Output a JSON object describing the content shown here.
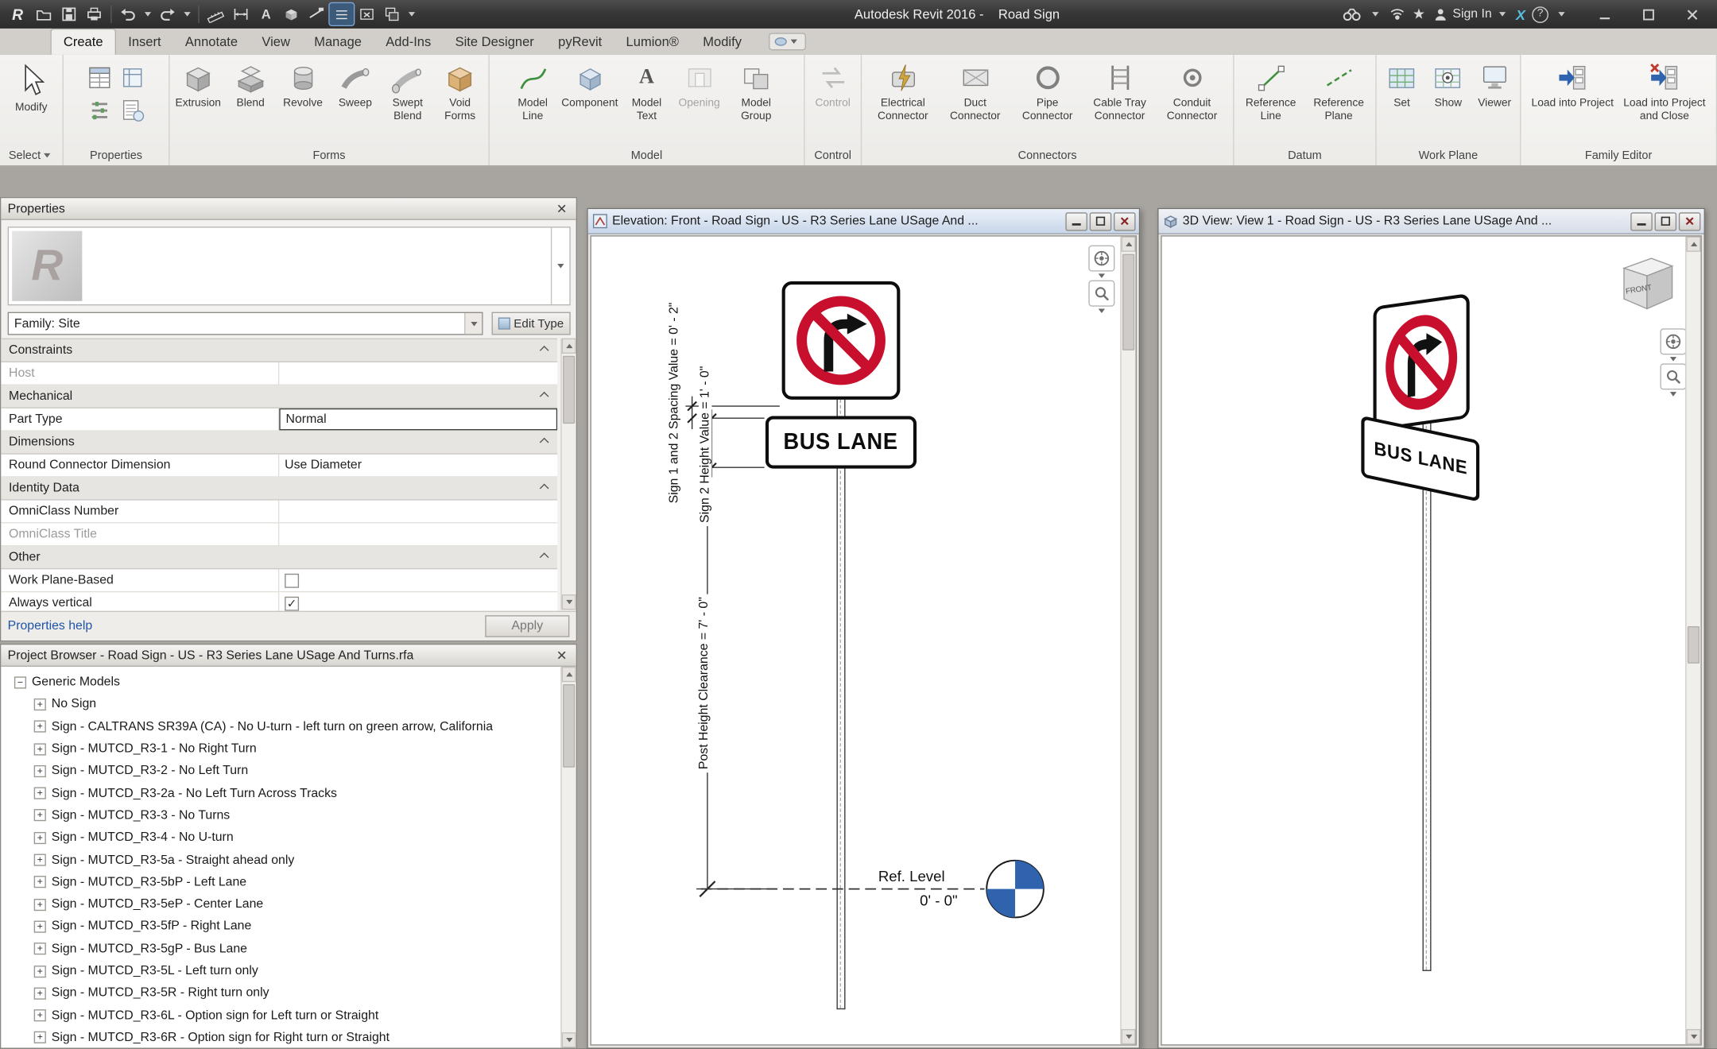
{
  "colors": {
    "sign_red": "#c8102e",
    "level_blue": "#2f63ad"
  },
  "titlebar": {
    "title": "Autodesk Revit 2016 -    Road Sign",
    "sign_in": "Sign In"
  },
  "tabs": [
    "Create",
    "Insert",
    "Annotate",
    "View",
    "Manage",
    "Add-Ins",
    "Site Designer",
    "pyRevit",
    "Lumion®",
    "Modify"
  ],
  "ribbon": {
    "select": {
      "modify": "Modify",
      "label": "Select"
    },
    "properties": {
      "label": "Properties"
    },
    "forms": {
      "label": "Forms",
      "buttons": [
        "Extrusion",
        "Blend",
        "Revolve",
        "Sweep",
        "Swept Blend",
        "Void Forms"
      ]
    },
    "model": {
      "label": "Model",
      "buttons": [
        "Model Line",
        "Component",
        "Model Text",
        "Opening",
        "Model Group"
      ]
    },
    "control": {
      "label": "Control",
      "buttons": [
        "Control"
      ]
    },
    "connectors": {
      "label": "Connectors",
      "buttons": [
        "Electrical Connector",
        "Duct Connector",
        "Pipe Connector",
        "Cable Tray Connector",
        "Conduit Connector"
      ]
    },
    "datum": {
      "label": "Datum",
      "buttons": [
        "Reference Line",
        "Reference Plane"
      ]
    },
    "workplane": {
      "label": "Work Plane",
      "buttons": [
        "Set",
        "Show",
        "Viewer"
      ]
    },
    "family_editor": {
      "label": "Family Editor",
      "buttons": [
        "Load into Project",
        "Load into Project and Close"
      ]
    }
  },
  "properties_palette": {
    "title": "Properties",
    "family_filter": "Family: Site",
    "edit_type": "Edit Type",
    "rows": [
      {
        "label": "Constraints"
      },
      {
        "label": "Host",
        "value": ""
      },
      {
        "label": "Mechanical"
      },
      {
        "label": "Part Type",
        "value": "Normal"
      },
      {
        "label": "Dimensions"
      },
      {
        "label": "Round Connector Dimension",
        "value": "Use Diameter"
      },
      {
        "label": "Identity Data"
      },
      {
        "label": "OmniClass Number",
        "value": ""
      },
      {
        "label": "OmniClass Title",
        "value": ""
      },
      {
        "label": "Other"
      },
      {
        "label": "Work Plane-Based",
        "checked": false
      },
      {
        "label": "Always vertical",
        "checked": true
      }
    ],
    "help_link": "Properties help",
    "apply": "Apply"
  },
  "project_browser": {
    "title": "Project Browser - Road Sign - US - R3 Series Lane USage And Turns.rfa",
    "root": "Generic Models",
    "items": [
      "No Sign",
      "Sign - CALTRANS SR39A (CA) - No U-turn - left turn on green arrow, California",
      "Sign - MUTCD_R3-1 - No Right Turn",
      "Sign - MUTCD_R3-2 - No Left Turn",
      "Sign - MUTCD_R3-2a - No Left Turn Across Tracks",
      "Sign - MUTCD_R3-3 - No Turns",
      "Sign - MUTCD_R3-4 - No U-turn",
      "Sign - MUTCD_R3-5a - Straight ahead only",
      "Sign - MUTCD_R3-5bP - Left Lane",
      "Sign - MUTCD_R3-5eP - Center Lane",
      "Sign - MUTCD_R3-5fP - Right Lane",
      "Sign - MUTCD_R3-5gP - Bus Lane",
      "Sign - MUTCD_R3-5L - Left turn only",
      "Sign - MUTCD_R3-5R - Right turn only",
      "Sign - MUTCD_R3-6L - Option sign for Left turn or Straight",
      "Sign - MUTCD_R3-6R - Option sign for Right turn or Straight"
    ]
  },
  "elevation": {
    "title": "Elevation: Front - Road Sign - US - R3 Series Lane USage And ...",
    "dim_spacing": "Sign 1 and 2 Spacing Value = 0' - 2\"",
    "dim_sign2_height": "Sign 2 Height Value = 1' - 0\"",
    "dim_clearance": "Post Height Clearance = 7' - 0\"",
    "ref_level": "Ref. Level",
    "ref_elevation": "0' - 0\"",
    "sign2_text": "BUS LANE"
  },
  "view3d": {
    "title": "3D View: View 1 - Road Sign - US - R3 Series Lane USage And ...",
    "viewcube_front": "FRONT",
    "sign2_text": "BUS LANE"
  }
}
